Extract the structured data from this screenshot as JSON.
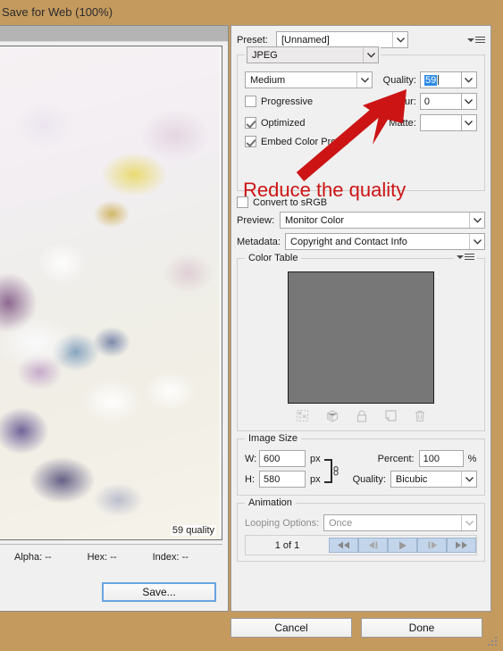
{
  "window": {
    "title": "Save for Web (100%)",
    "accent_color": "#c49a5e"
  },
  "preview": {
    "quality_label": "59 quality",
    "status": {
      "alpha": "Alpha: --",
      "hex": "Hex: --",
      "index": "Index: --"
    },
    "save_button": "Save..."
  },
  "settings": {
    "preset": {
      "label": "Preset:",
      "value": "[Unnamed]"
    },
    "format": {
      "value": "JPEG"
    },
    "quality_preset": {
      "value": "Medium"
    },
    "quality": {
      "label": "Quality:",
      "value": "59"
    },
    "blur": {
      "label": "Blur:",
      "value": "0"
    },
    "matte": {
      "label": "Matte:",
      "value": ""
    },
    "checkboxes": [
      {
        "label": "Progressive",
        "checked": false
      },
      {
        "label": "Optimized",
        "checked": true
      },
      {
        "label": "Embed Color Profile",
        "checked": true
      },
      {
        "label": "Convert to sRGB",
        "checked": false
      }
    ],
    "preview_mode": {
      "label": "Preview:",
      "value": "Monitor Color"
    },
    "metadata": {
      "label": "Metadata:",
      "value": "Copyright and Contact Info"
    }
  },
  "color_table": {
    "title": "Color Table",
    "tools": [
      "transparency-icon",
      "web-snap-cube-icon",
      "lock-icon",
      "new-swatch-icon",
      "trash-icon"
    ]
  },
  "image_size": {
    "title": "Image Size",
    "width": {
      "label": "W:",
      "value": "600",
      "unit": "px"
    },
    "height": {
      "label": "H:",
      "value": "580",
      "unit": "px"
    },
    "percent": {
      "label": "Percent:",
      "value": "100",
      "unit": "%"
    },
    "resample": {
      "label": "Quality:",
      "value": "Bicubic"
    }
  },
  "animation": {
    "title": "Animation",
    "looping": {
      "label": "Looping Options:",
      "value": "Once"
    },
    "frame_count": "1 of 1",
    "controls": [
      "first-frame-icon",
      "previous-frame-icon",
      "play-icon",
      "next-frame-icon",
      "last-frame-icon"
    ]
  },
  "footer": {
    "cancel": "Cancel",
    "done": "Done"
  },
  "annotation": {
    "text": "Reduce the quality",
    "color": "#cc1414"
  }
}
